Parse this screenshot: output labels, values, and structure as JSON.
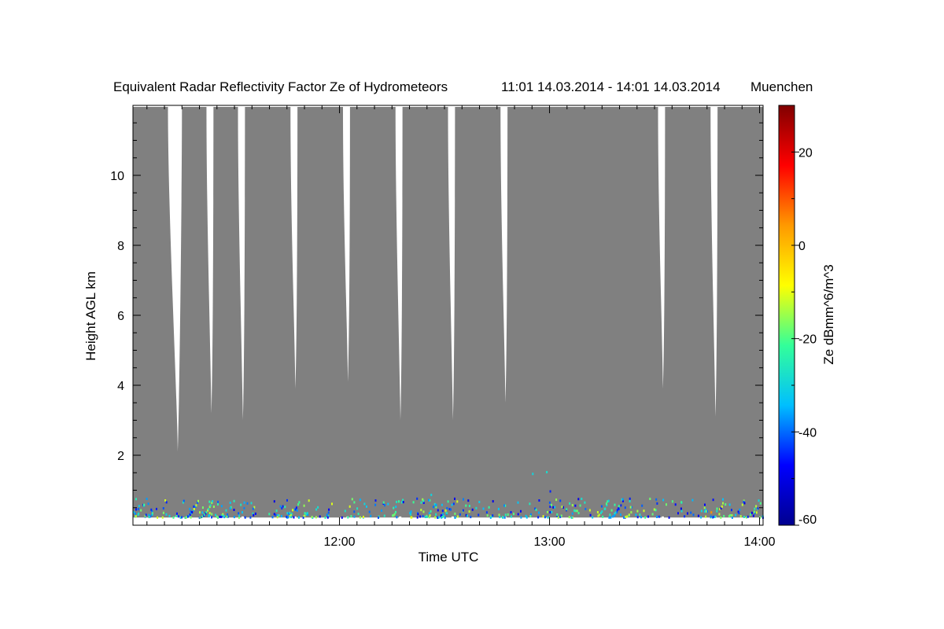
{
  "chart_data": {
    "type": "heatmap",
    "title": "Equivalent Radar Reflectivity Factor Ze of Hydrometeors",
    "time_range": "11:01 14.03.2014 - 14:01 14.03.2014",
    "location": "Muenchen",
    "xlabel": "Time UTC",
    "ylabel": "Height AGL km",
    "xlim": [
      "11:01",
      "14:01"
    ],
    "x_ticks": [
      "12:00",
      "13:00",
      "14:00"
    ],
    "ylim": [
      0,
      12
    ],
    "y_ticks": [
      2,
      4,
      6,
      8,
      10
    ],
    "colorbar": {
      "label": "Ze dBmm^6/m^3",
      "range": [
        -60,
        30
      ],
      "ticks": [
        -60,
        -40,
        -20,
        0,
        20
      ]
    },
    "no_signal_color": "#808080",
    "colormap": [
      "#00008f",
      "#0000ff",
      "#00bfff",
      "#33ff99",
      "#ffff00",
      "#ff9900",
      "#ff0000",
      "#800000"
    ],
    "data_gaps": [
      {
        "start": "11:11",
        "end": "11:15",
        "min_height_km": 2.1
      },
      {
        "start": "11:22",
        "end": "11:24",
        "min_height_km": 3.2
      },
      {
        "start": "11:31",
        "end": "11:33",
        "min_height_km": 3.0
      },
      {
        "start": "11:46",
        "end": "11:48",
        "min_height_km": 3.9
      },
      {
        "start": "12:01",
        "end": "12:03",
        "min_height_km": 4.1
      },
      {
        "start": "12:16",
        "end": "12:18",
        "min_height_km": 3.0
      },
      {
        "start": "12:31",
        "end": "12:33",
        "min_height_km": 3.0
      },
      {
        "start": "12:46",
        "end": "12:48",
        "min_height_km": 3.5
      },
      {
        "start": "13:31",
        "end": "13:33",
        "min_height_km": 3.9
      },
      {
        "start": "13:46",
        "end": "13:48",
        "min_height_km": 3.1
      }
    ],
    "echo_layer": {
      "height_km": [
        0.25,
        0.8
      ],
      "ze_dbz_range": [
        -50,
        -10
      ]
    },
    "scattered_echoes": [
      {
        "time": "12:55",
        "height_km": 1.5,
        "ze": -30
      },
      {
        "time": "12:59",
        "height_km": 1.55,
        "ze": -28
      },
      {
        "time": "13:00",
        "height_km": 1.0,
        "ze": -45
      },
      {
        "time": "12:26",
        "height_km": 0.9,
        "ze": -30
      },
      {
        "time": "13:46",
        "height_km": 0.4,
        "ze": 5
      }
    ]
  }
}
